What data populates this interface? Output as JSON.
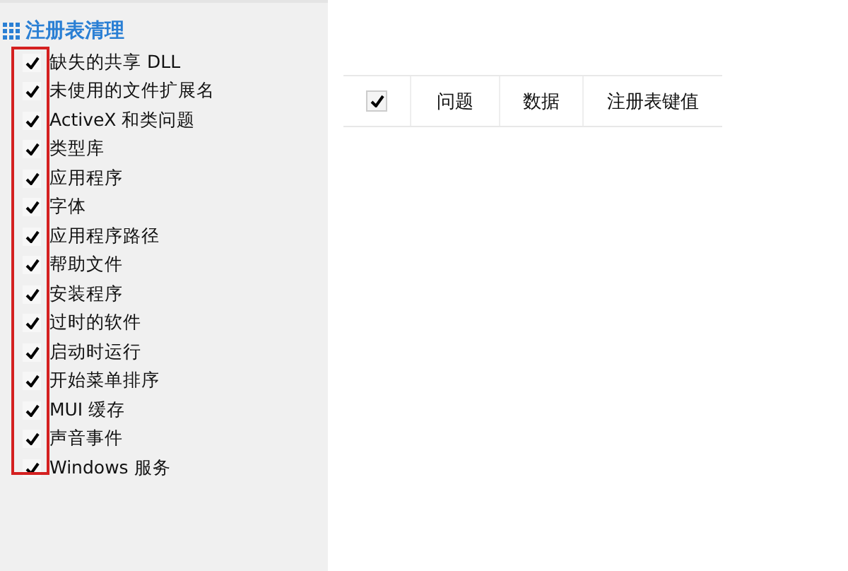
{
  "sidebar": {
    "title": "注册表清理",
    "highlighted": true,
    "items": [
      {
        "label": "缺失的共享 DLL",
        "checked": true
      },
      {
        "label": "未使用的文件扩展名",
        "checked": true
      },
      {
        "label": "ActiveX 和类问题",
        "checked": true
      },
      {
        "label": "类型库",
        "checked": true
      },
      {
        "label": "应用程序",
        "checked": true
      },
      {
        "label": "字体",
        "checked": true
      },
      {
        "label": "应用程序路径",
        "checked": true
      },
      {
        "label": "帮助文件",
        "checked": true
      },
      {
        "label": "安装程序",
        "checked": true
      },
      {
        "label": "过时的软件",
        "checked": true
      },
      {
        "label": "启动时运行",
        "checked": true
      },
      {
        "label": "开始菜单排序",
        "checked": true
      },
      {
        "label": "MUI 缓存",
        "checked": true
      },
      {
        "label": "声音事件",
        "checked": true
      },
      {
        "label": "Windows 服务",
        "checked": true
      }
    ]
  },
  "table": {
    "select_all_checked": true,
    "columns": [
      "问题",
      "数据",
      "注册表键值"
    ]
  }
}
